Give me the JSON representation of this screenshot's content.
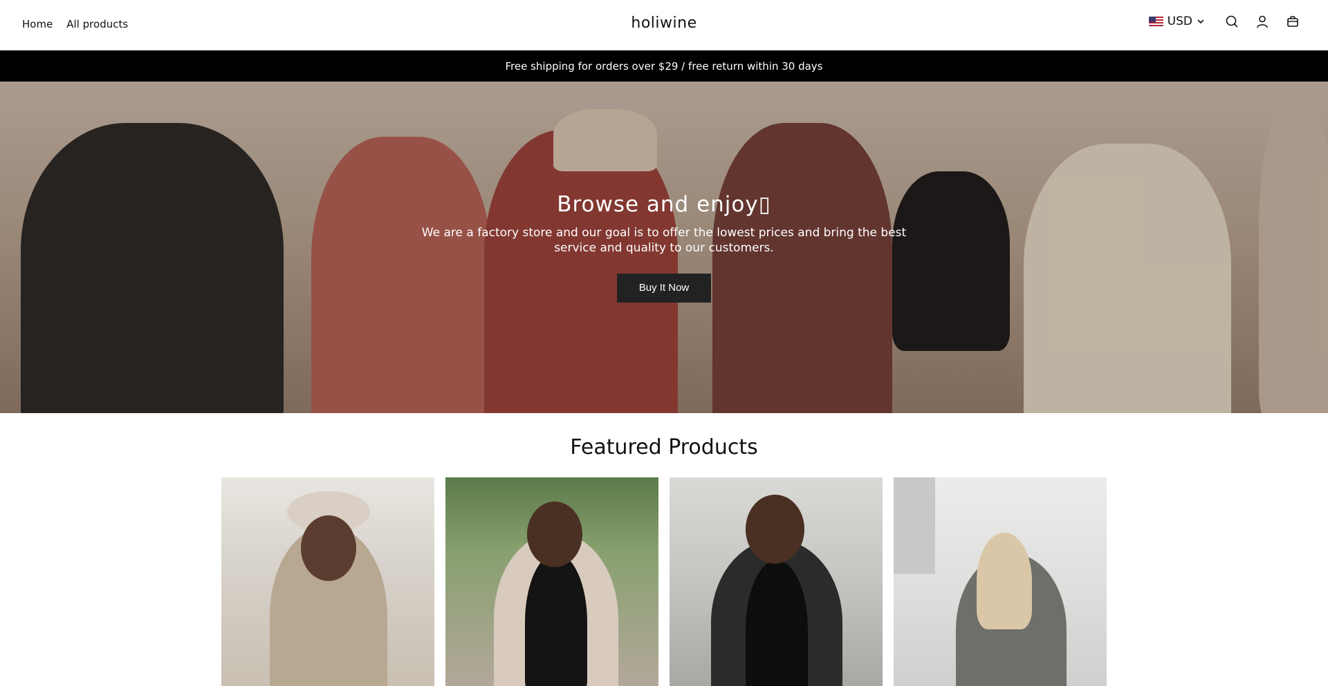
{
  "header": {
    "nav": [
      {
        "label": "Home"
      },
      {
        "label": "All products"
      }
    ],
    "brand": "holiwine",
    "currency": "USD",
    "icons": [
      "search-icon",
      "account-icon",
      "cart-icon"
    ]
  },
  "announcement": "Free shipping for orders over $29 / free return within 30 days",
  "hero": {
    "title": "Browse and enjoy▯",
    "text": "We are a factory store and our goal is to offer the lowest prices and bring the best service and quality to our customers.",
    "button": "Buy It Now"
  },
  "featured": {
    "title": "Featured Products"
  },
  "colors": {
    "announcement_bg": "#000000",
    "button_bg": "#222222",
    "text": "#111111"
  }
}
